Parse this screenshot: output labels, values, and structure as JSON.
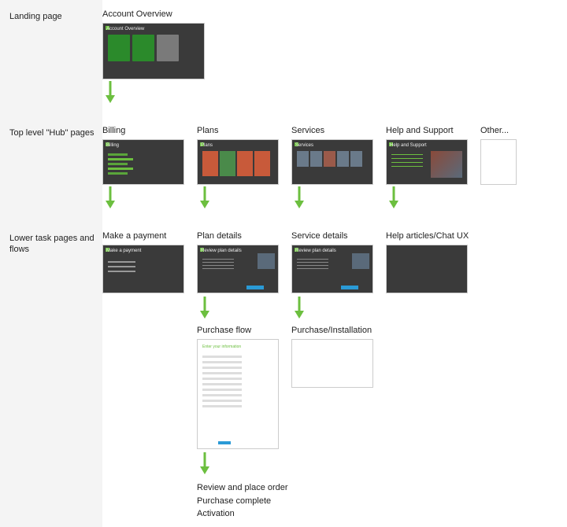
{
  "rows": {
    "landing": {
      "label": "Landing page"
    },
    "hub": {
      "label": "Top level \"Hub\" pages"
    },
    "task": {
      "label": "Lower task pages and flows"
    }
  },
  "landing": {
    "title": "Account Overview",
    "thumb_header": "Account Overview"
  },
  "hub": {
    "billing": {
      "title": "Billing",
      "thumb_header": "Billing"
    },
    "plans": {
      "title": "Plans",
      "thumb_header": "Plans"
    },
    "services": {
      "title": "Services",
      "thumb_header": "Services"
    },
    "help": {
      "title": "Help and Support",
      "thumb_header": "Help and Support"
    },
    "other": {
      "title": "Other..."
    }
  },
  "task1": {
    "payment": {
      "title": "Make a payment",
      "thumb_header": "Make a payment"
    },
    "plan_details": {
      "title": "Plan details",
      "thumb_header": "Review plan details"
    },
    "service_details": {
      "title": "Service details",
      "thumb_header": "Review plan details"
    },
    "help_articles": {
      "title": "Help articles/Chat UX"
    }
  },
  "task2": {
    "purchase_flow": {
      "title": "Purchase flow",
      "thumb_header": "Enter your information"
    },
    "purchase_install": {
      "title": "Purchase/Installation"
    }
  },
  "sub": {
    "s1": "Review and place order",
    "s2": "Purchase complete",
    "s3": "Activation"
  },
  "colors": {
    "accent": "#6cbf3f"
  }
}
